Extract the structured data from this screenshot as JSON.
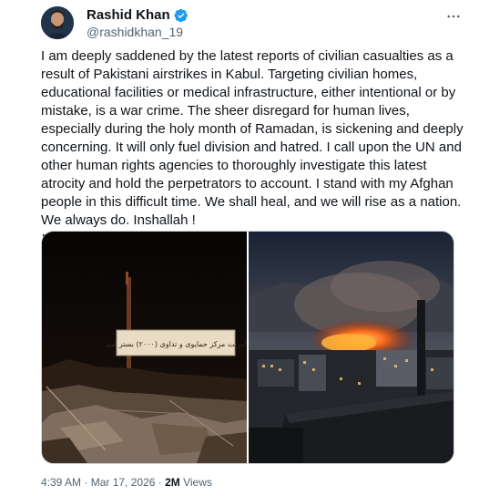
{
  "author": {
    "name": "Rashid Khan",
    "handle": "@rashidkhan_19"
  },
  "tweet": {
    "text": "I am deeply saddened by the latest reports of civilian casualties as a result of Pakistani airstrikes in Kabul. Targeting civilian homes, educational facilities or medical infrastructure, either intentional or by mistake, is a war crime. The sheer disregard for human lives, especially during the holy month of Ramadan, is sickening and deeply concerning. It will only fuel division and hatred. I call upon the UN and other human rights agencies to thoroughly investigate this latest atrocity and hold the perpetrators to account. I stand with my Afghan people in this difficult time. We shall heal, and we will rise as a nation. We always do. Inshallah !",
    "flag_icon": "afghanistan-flag-icon",
    "sign_text": "آمریت مرکز حمایوی و تداوی (۲۰۰۰) بستر امید"
  },
  "meta": {
    "time": "4:39 AM",
    "separator": " · ",
    "date": "Mar 17, 2026",
    "views_count": "2M",
    "views_label": " Views"
  },
  "colors": {
    "text": "#0f1419",
    "secondary": "#536471",
    "verified": "#1d9bf0"
  },
  "icons": {
    "verified": "verified-badge-icon",
    "more": "more-options-icon"
  }
}
